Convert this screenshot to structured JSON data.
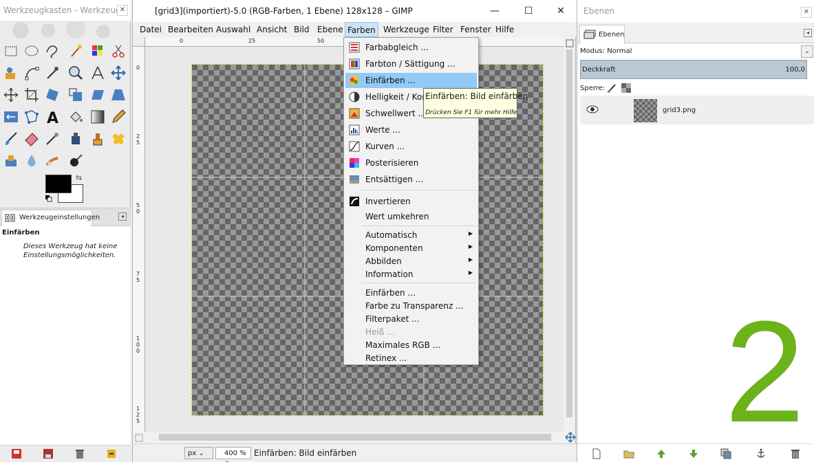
{
  "toolbox": {
    "title": "Werkzeugkasten - Werkzeug...",
    "close": "✕",
    "dock_tab_label": "Werkzeugeinstellungen",
    "options_heading": "Einfärben",
    "options_desc": "Dieses Werkzeug hat keine Einstellungsmöglichkeiten."
  },
  "image_window": {
    "title": "[grid3](importiert)-5.0 (RGB-Farben, 1 Ebene) 128x128 – GIMP",
    "menus": [
      "Datei",
      "Bearbeiten",
      "Auswahl",
      "Ansicht",
      "Bild",
      "Ebene",
      "Farben",
      "Werkzeuge",
      "Filter",
      "Fenster",
      "Hilfe"
    ],
    "active_menu": "Farben",
    "ruler_top": [
      "0",
      "25",
      "50"
    ],
    "ruler_left": [
      "0",
      "2 5",
      "5 0",
      "7 5",
      "1 0 0",
      "1 2 5"
    ],
    "unit": "px",
    "zoom": "400 %",
    "status": "Einfärben: Bild einfärben"
  },
  "colors_menu": {
    "items": [
      {
        "label": "Farbabgleich ...",
        "icon": "color-balance-icon"
      },
      {
        "label": "Farbton / Sättigung ...",
        "icon": "hue-saturation-icon"
      },
      {
        "label": "Einfärben ...",
        "icon": "colorize-icon",
        "highlighted": true
      },
      {
        "label": "Helligkeit / Kont",
        "icon": "brightness-contrast-icon"
      },
      {
        "label": "Schwellwert ...",
        "icon": "threshold-icon"
      },
      {
        "label": "Werte ...",
        "icon": "levels-icon"
      },
      {
        "label": "Kurven ...",
        "icon": "curves-icon"
      },
      {
        "label": "Posterisieren",
        "icon": "posterize-icon"
      },
      {
        "label": "Entsättigen ...",
        "icon": "desaturate-icon"
      }
    ],
    "items2": [
      {
        "label": "Invertieren",
        "icon": "invert-icon"
      },
      {
        "label": "Wert umkehren",
        "icon": ""
      }
    ],
    "submenus": [
      "Automatisch",
      "Komponenten",
      "Abbilden",
      "Information"
    ],
    "items3": [
      {
        "label": "Einfärben ...",
        "disabled": false
      },
      {
        "label": "Farbe zu Transparenz ...",
        "disabled": false
      },
      {
        "label": "Filterpaket ...",
        "disabled": false
      },
      {
        "label": "Heiß ...",
        "disabled": true
      },
      {
        "label": "Maximales RGB ...",
        "disabled": false
      },
      {
        "label": "Retinex ...",
        "disabled": false
      }
    ]
  },
  "tooltip": {
    "text": "Einfärben: Bild einfärben",
    "hint": "Drücken Sie F1 für mehr Hilfe"
  },
  "layers": {
    "title": "Ebenen",
    "tab_label": "Ebenen",
    "mode_label": "Modus: Normal",
    "opacity_label": "Deckkraft",
    "opacity_value": "100,0",
    "lock_label": "Sperre:",
    "layer_name": "grid3.png",
    "step_number": "2"
  },
  "colors": {
    "menu_highlight": "#91c9f7",
    "active_menu_bg": "#cce4f7",
    "step_number": "#6cb31b",
    "tooltip_bg": "#ffffe1"
  }
}
